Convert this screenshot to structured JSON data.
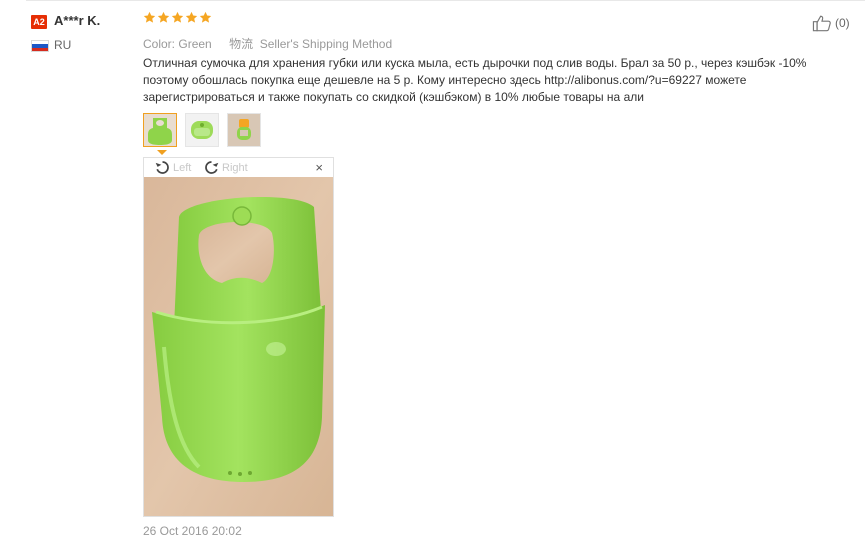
{
  "reviewer": {
    "badge": "A2",
    "name": "A***r K.",
    "country": "RU"
  },
  "rating": {
    "stars": 5,
    "max": 5,
    "color": "#f5a623"
  },
  "meta": {
    "color_label": "Color:",
    "color_value": "Green",
    "shipping_label": "物流",
    "shipping_value": "Seller's Shipping Method"
  },
  "review": {
    "text": "Отличная сумочка для хранения губки или куска мыла, есть дырочки под слив воды. Брал за 50 р., через кэшбэк -10% поэтому обошлась покупка еще дешевле на 5 р. Кому интересно здесь http://alibonus.com/?u=69227 можете зарегистрироваться и также покупать со скидкой (кэшбэком) в 10% любые товары на али"
  },
  "viewer": {
    "rotate_left": "Left",
    "rotate_right": "Right",
    "close": "×"
  },
  "thumbnails": [
    "photo-1",
    "photo-2",
    "photo-3"
  ],
  "date": "26 Oct 2016 20:02",
  "helpful": {
    "count": "(0)"
  },
  "colors": {
    "badge": "#e62e04",
    "accent": "#f0a020",
    "product_green": "#8fd44a"
  },
  "icons": [
    "star-icon",
    "thumbs-up-icon",
    "rotate-left-icon",
    "rotate-right-icon",
    "close-icon",
    "flag-icon"
  ]
}
